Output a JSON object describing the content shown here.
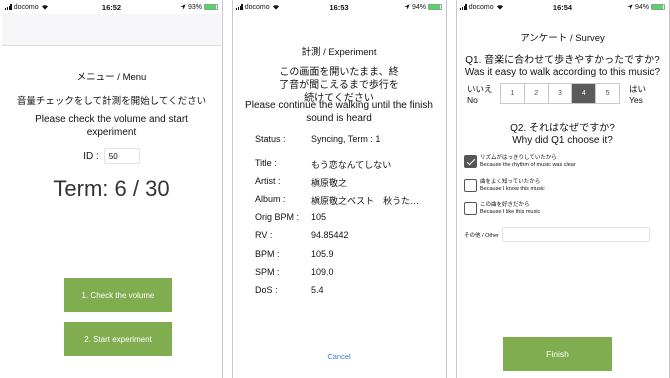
{
  "colors": {
    "accent_green": "#7fad4f",
    "link_blue": "#3a7bd5",
    "battery_green": "#4cd964",
    "selected_scale": "#5a5a5a"
  },
  "screen1": {
    "status": {
      "carrier": "docomo",
      "time": "16:52",
      "battery": "93%",
      "battery_level": 0.93
    },
    "title": "メニュー / Menu",
    "instruction_ja": "音量チェックをして計測を開始してください",
    "instruction_en": "Please check the volume and start experiment",
    "id_label": "ID :",
    "id_value": "50",
    "term": "Term: 6 / 30",
    "check_volume_button": "1. Check the volume",
    "start_button": "2. Start experiment"
  },
  "screen2": {
    "status": {
      "carrier": "docomo",
      "time": "16:53",
      "battery": "94%",
      "battery_level": 0.94
    },
    "title": "計測 / Experiment",
    "message_ja": "この画面を開いたまま、終了音が聞こえるまで歩行を続けてください",
    "message_en": "Please continue the walking until the finish sound is heard",
    "info": [
      {
        "key": "Status :",
        "value": "Syncing, Term : 1"
      },
      {
        "key": "Title :",
        "value": "もう恋なんてしない"
      },
      {
        "key": "Artist :",
        "value": "槇原敬之"
      },
      {
        "key": "Album :",
        "value": "槇原敬之ベスト　秋うた…"
      },
      {
        "key": "Orig BPM :",
        "value": "105"
      },
      {
        "key": "RV :",
        "value": "94.85442"
      },
      {
        "key": "BPM :",
        "value": "105.9"
      },
      {
        "key": "SPM :",
        "value": "109.0"
      },
      {
        "key": "DoS :",
        "value": "5.4"
      }
    ],
    "cancel": "Cancel"
  },
  "screen3": {
    "status": {
      "carrier": "docomo",
      "time": "16:54",
      "battery": "94%",
      "battery_level": 0.94
    },
    "title": "アンケート / Survey",
    "q1_ja": "Q1. 音楽に合わせて歩きやすかったですか?",
    "q1_en": "Was it easy to walk according to this music?",
    "scale_left_ja": "いいえ",
    "scale_left_en": "No",
    "scale_right_ja": "はい",
    "scale_right_en": "Yes",
    "scale": [
      "1",
      "2",
      "3",
      "4",
      "5"
    ],
    "scale_selected": 4,
    "q2_ja": "Q2. それはなぜですか?",
    "q2_en": "Why did Q1 choose it?",
    "options": [
      {
        "ja": "リズムがはっきりしていたから",
        "en": "Because the rhythm of music was clear",
        "checked": true
      },
      {
        "ja": "曲をよく知っていたから",
        "en": "Because I know this music",
        "checked": false
      },
      {
        "ja": "この曲を好きだから",
        "en": "Because I like this music",
        "checked": false
      }
    ],
    "other_label": "その他 / Other",
    "other_value": "",
    "finish_button": "Finish"
  }
}
